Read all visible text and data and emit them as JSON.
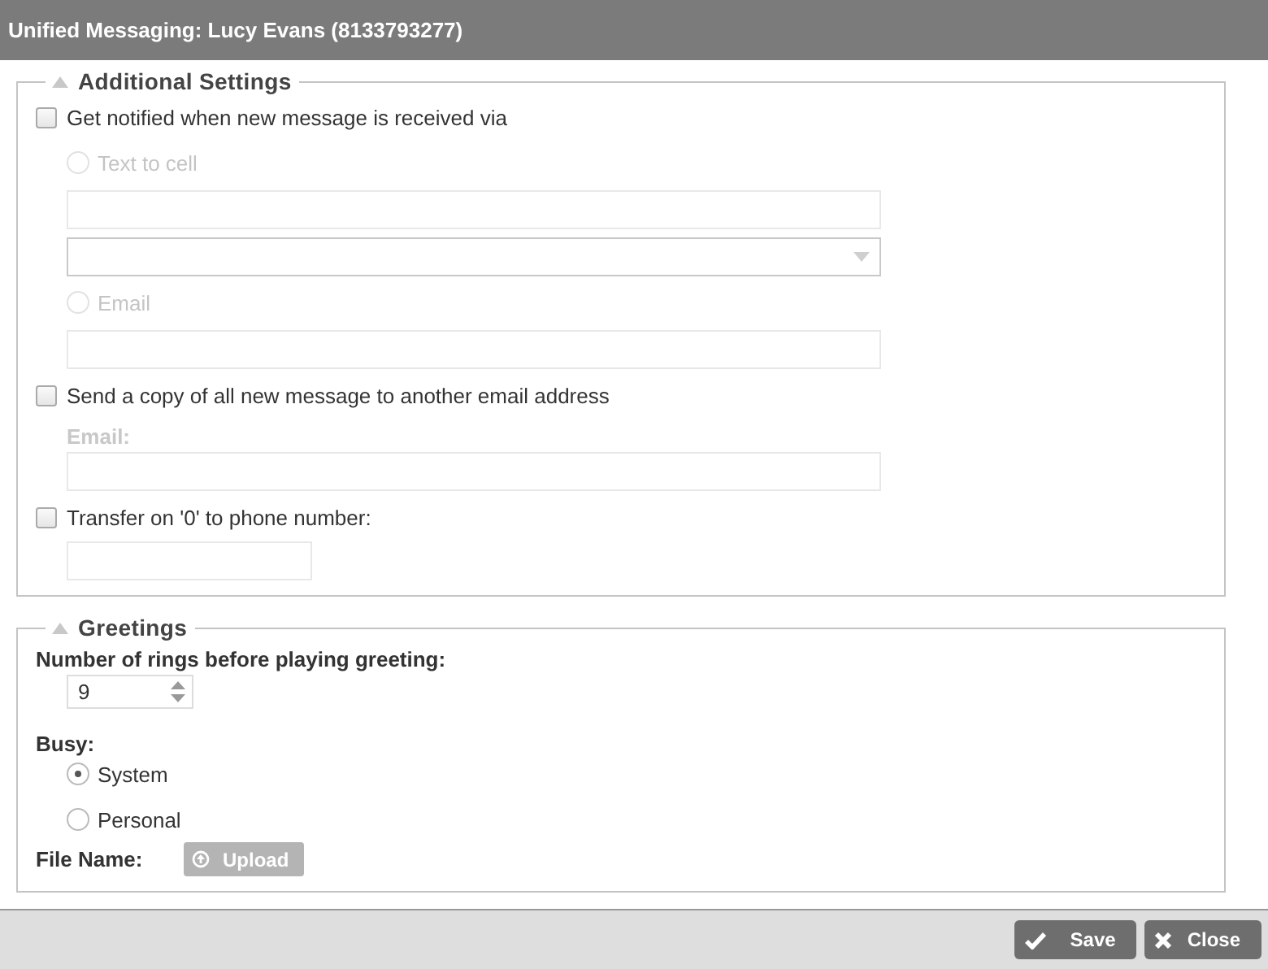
{
  "window": {
    "title": "Unified Messaging: Lucy Evans (8133793277)"
  },
  "additional_settings": {
    "title": "Additional Settings",
    "items": [
      {
        "kind": "checkbox",
        "label": "Get notified when new message is received via",
        "checked": false
      },
      {
        "kind": "radio",
        "label": "Text to cell",
        "selected": false,
        "disabled": true
      },
      {
        "kind": "field"
      },
      {
        "kind": "select"
      },
      {
        "kind": "radio",
        "label": "Email",
        "selected": false,
        "disabled": true
      },
      {
        "kind": "field"
      },
      {
        "kind": "checkbox",
        "label": "Send a copy of all new message to another email address",
        "checked": false
      },
      {
        "kind": "label",
        "label": "Email:",
        "disabled": true
      },
      {
        "kind": "field"
      },
      {
        "kind": "checkbox",
        "label": "Transfer on '0' to phone number:",
        "checked": false
      },
      {
        "kind": "short_field"
      }
    ]
  },
  "greetings": {
    "title": "Greetings",
    "rings_label": "Number of rings before playing greeting:",
    "rings_value": "9",
    "busy_label": "Busy:",
    "busy_options": [
      {
        "label": "System",
        "selected": true
      },
      {
        "label": "Personal",
        "selected": false
      }
    ],
    "file_name_label": "File Name:",
    "upload_button": "Upload"
  },
  "buttons": [
    {
      "kind": "save",
      "label": "Save"
    },
    {
      "kind": "close",
      "label": "Close"
    }
  ]
}
